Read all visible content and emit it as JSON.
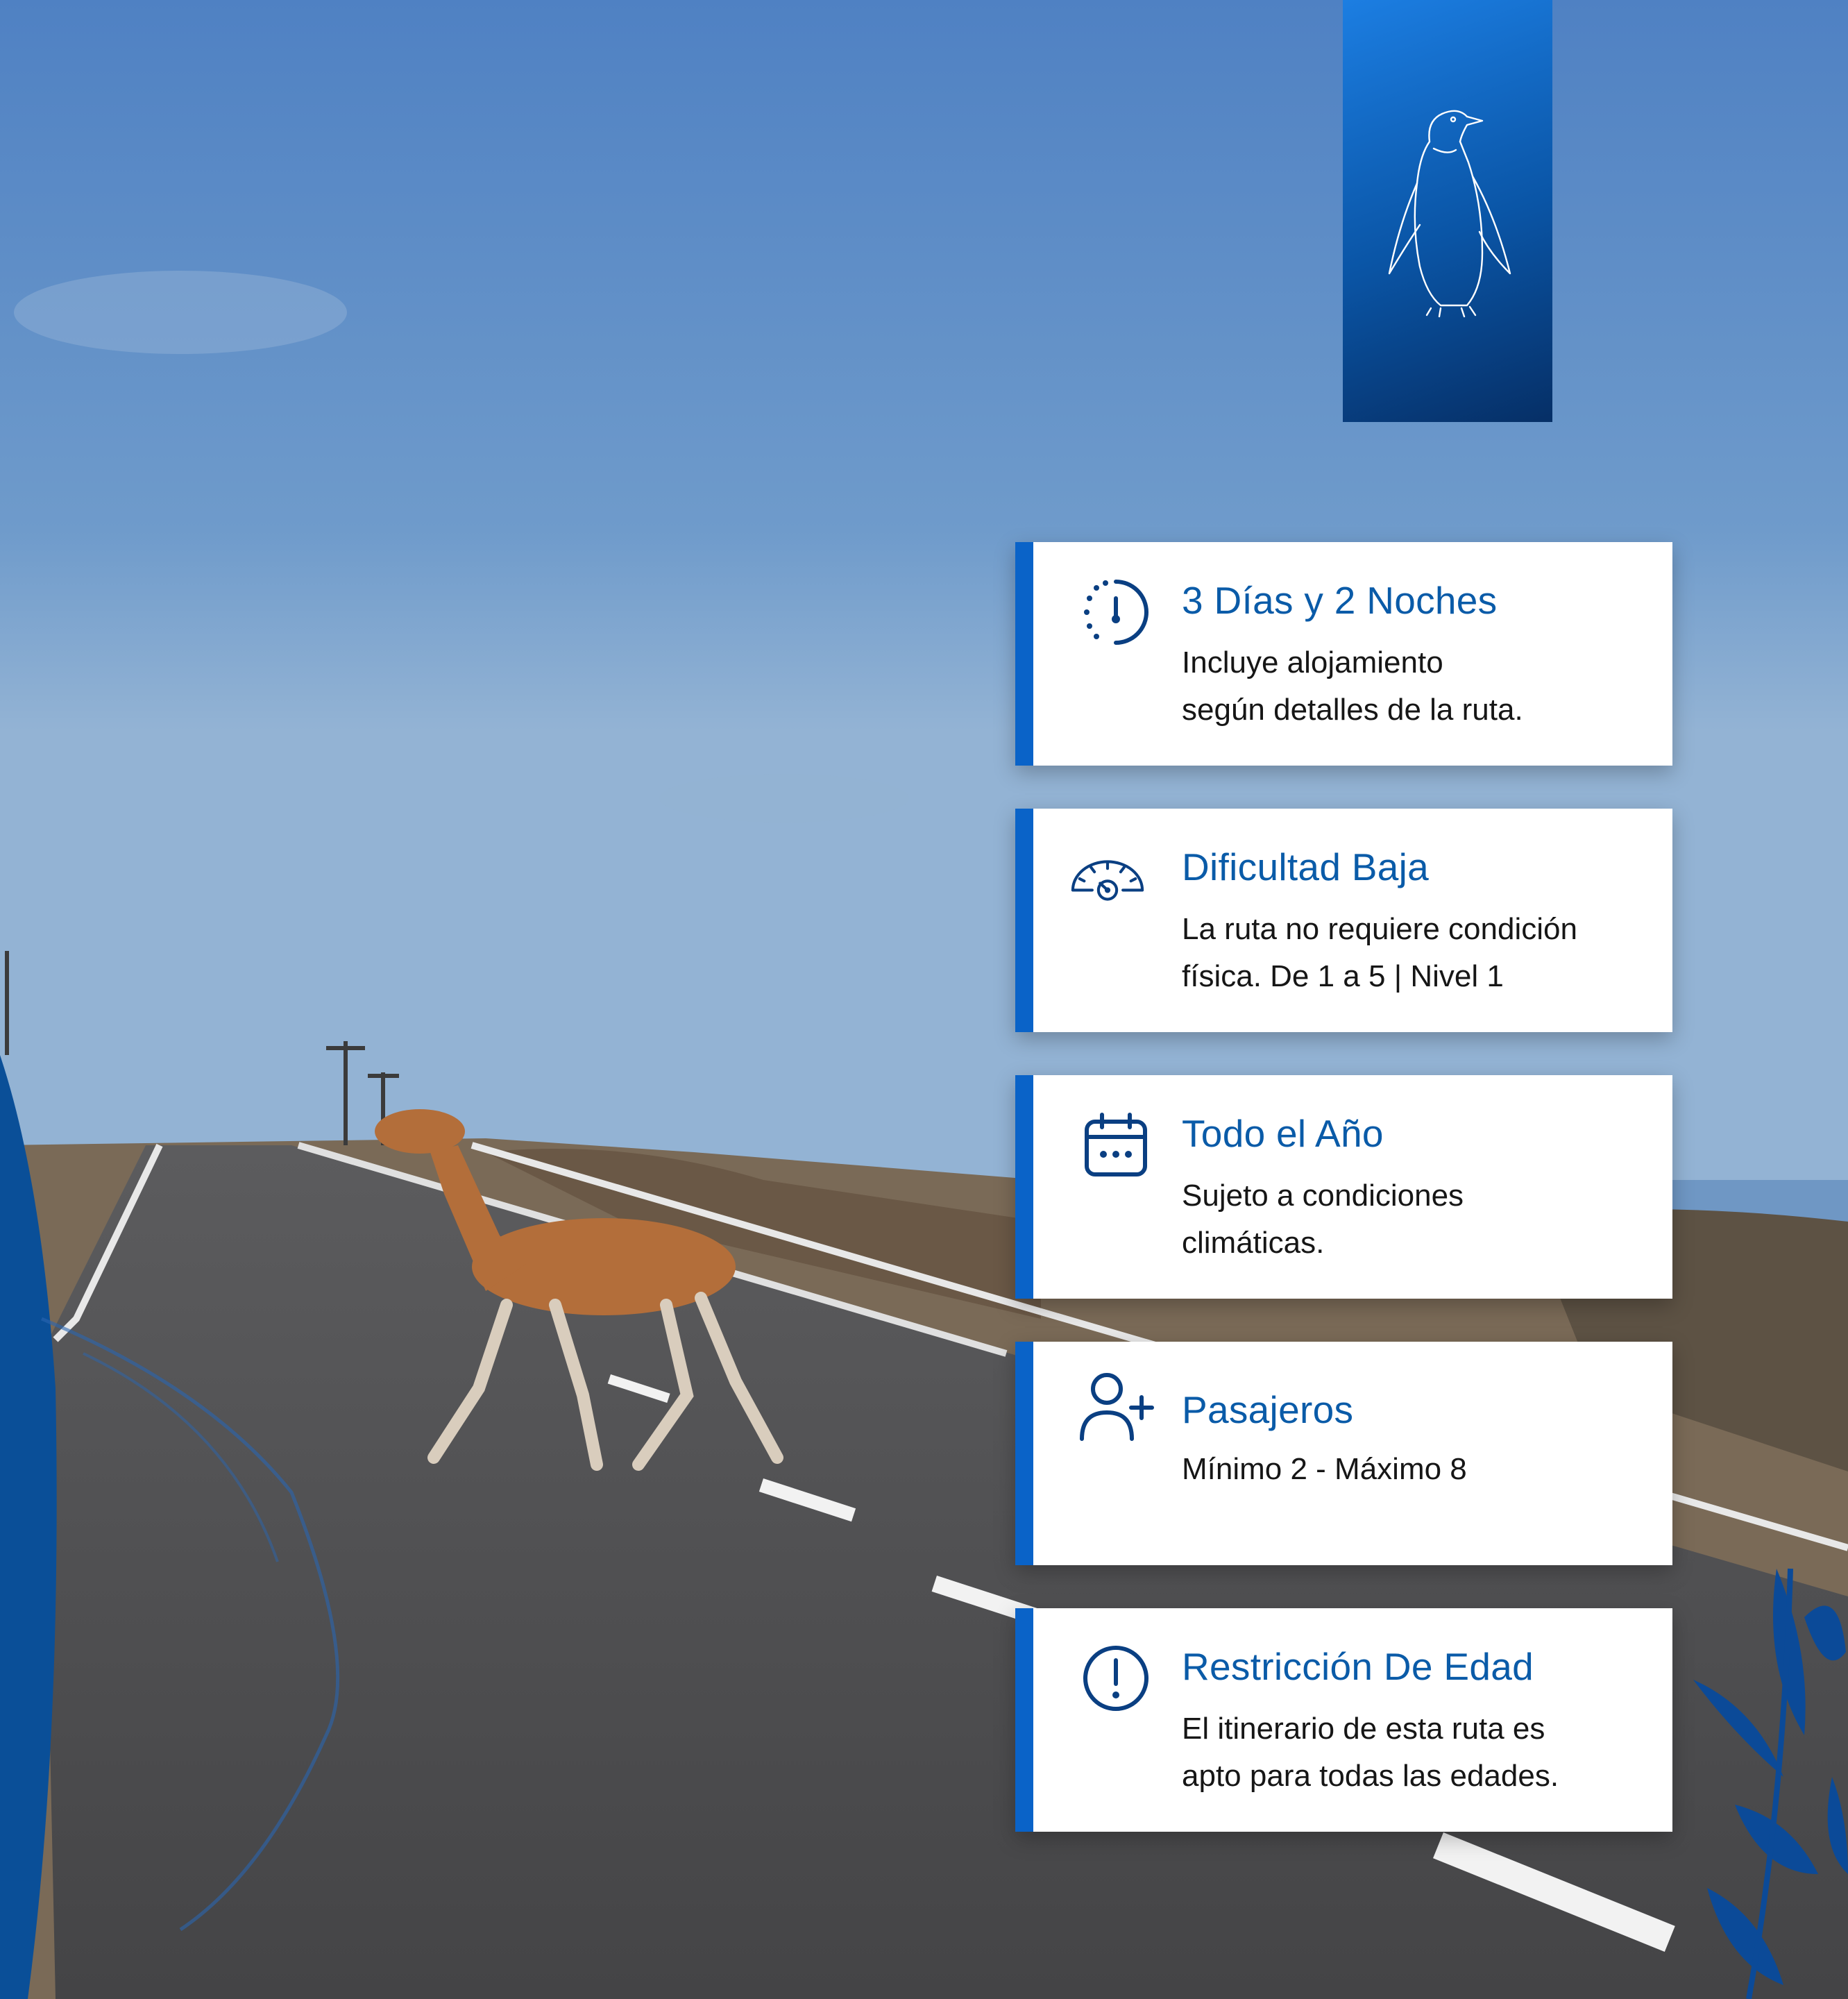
{
  "colors": {
    "accent": "#0a63c8",
    "title_text": "#0a5ba8",
    "body_text": "#161616",
    "card_bg": "#ffffff",
    "sky": "#6f97c4",
    "road": "#4e4e4e"
  },
  "decor": {
    "penguin_panel_icon": "penguin-icon",
    "photo_subject": "guanaco-crossing-road"
  },
  "cards": [
    {
      "icon": "clock-icon",
      "title": "3 Días y 2 Noches",
      "lines": [
        "Incluye alojamiento",
        "según detalles de la ruta."
      ]
    },
    {
      "icon": "speedometer-icon",
      "title": "Dificultad Baja",
      "lines": [
        "La ruta no requiere condición",
        "física. De 1 a 5 | Nivel 1"
      ]
    },
    {
      "icon": "calendar-icon",
      "title": "Todo el Año",
      "lines": [
        "Sujeto a condiciones",
        "climáticas."
      ]
    },
    {
      "icon": "add-user-icon",
      "title": "Pasajeros",
      "lines": [
        "Mínimo 2 - Máximo 8",
        ""
      ]
    },
    {
      "icon": "alert-icon",
      "title": "Restricción De Edad",
      "lines": [
        "El itinerario de esta ruta es",
        "apto para todas las edades."
      ]
    }
  ]
}
